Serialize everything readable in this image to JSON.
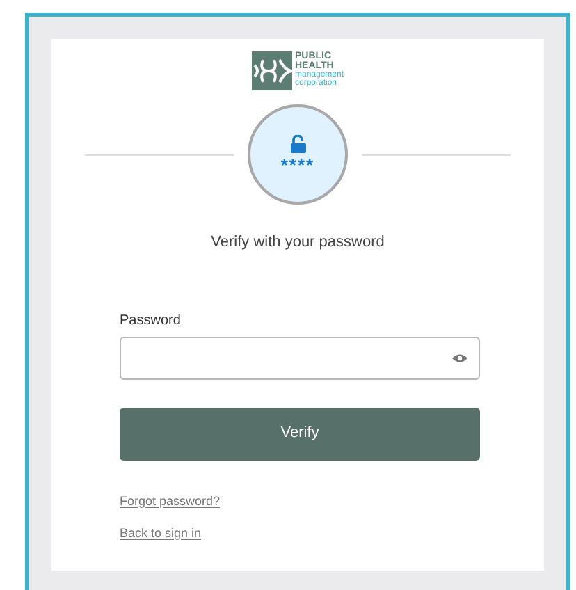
{
  "logo": {
    "lines": [
      "PUBLIC",
      "HEALTH"
    ],
    "tagline": [
      "management",
      "corporation"
    ]
  },
  "authenticator": {
    "mask": "****"
  },
  "heading": "Verify with your password",
  "password_field": {
    "label": "Password"
  },
  "buttons": [
    {
      "label": "Verify",
      "kind": "primary"
    }
  ],
  "links": [
    "Forgot password?",
    "Back to sign in"
  ]
}
